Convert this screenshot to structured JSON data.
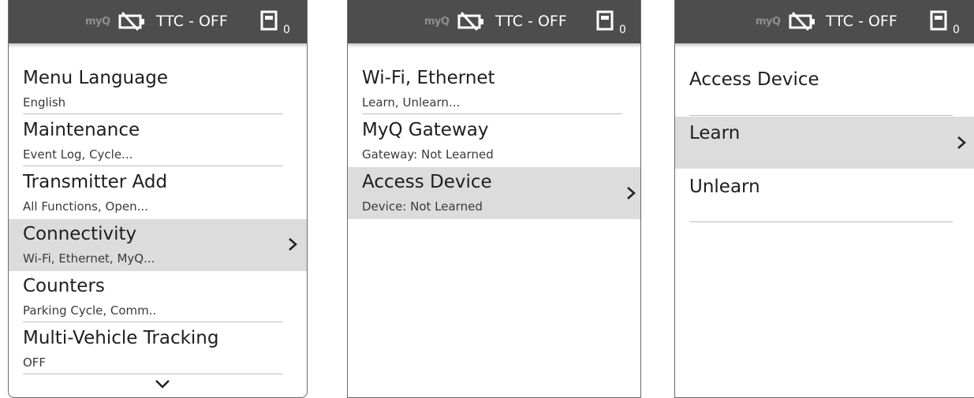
{
  "status_bar": {
    "myq_logo": "myQ",
    "ttc_status": "TTC - OFF",
    "device_count": "0"
  },
  "screen1": {
    "items": [
      {
        "title": "Menu Language",
        "subtitle": "English"
      },
      {
        "title": "Maintenance",
        "subtitle": "Event Log, Cycle..."
      },
      {
        "title": "Transmitter Add",
        "subtitle": "All Functions, Open..."
      },
      {
        "title": "Connectivity",
        "subtitle": "Wi-Fi, Ethernet, MyQ..."
      },
      {
        "title": "Counters",
        "subtitle": "Parking Cycle, Comm.."
      },
      {
        "title": "Multi-Vehicle Tracking",
        "subtitle": "OFF"
      }
    ],
    "selected_index": 3
  },
  "screen2": {
    "items": [
      {
        "title": "Wi-Fi, Ethernet",
        "subtitle": "Learn, Unlearn..."
      },
      {
        "title": "MyQ Gateway",
        "subtitle": "Gateway: Not Learned"
      },
      {
        "title": "Access Device",
        "subtitle": "Device: Not Learned"
      }
    ],
    "selected_index": 2
  },
  "screen3": {
    "heading": "Access Device",
    "items": [
      {
        "title": "Learn"
      },
      {
        "title": "Unlearn"
      }
    ],
    "selected_index": 0
  },
  "icons": {
    "battery": "battery-crossed-icon",
    "device": "device-box-icon",
    "chevron_right": "chevron-right-icon",
    "chevron_down": "chevron-down-icon"
  },
  "colors": {
    "status_bar_bg": "#4d4d4d",
    "selected_row_bg": "#dcdcdc",
    "text": "#1e1e1e"
  }
}
